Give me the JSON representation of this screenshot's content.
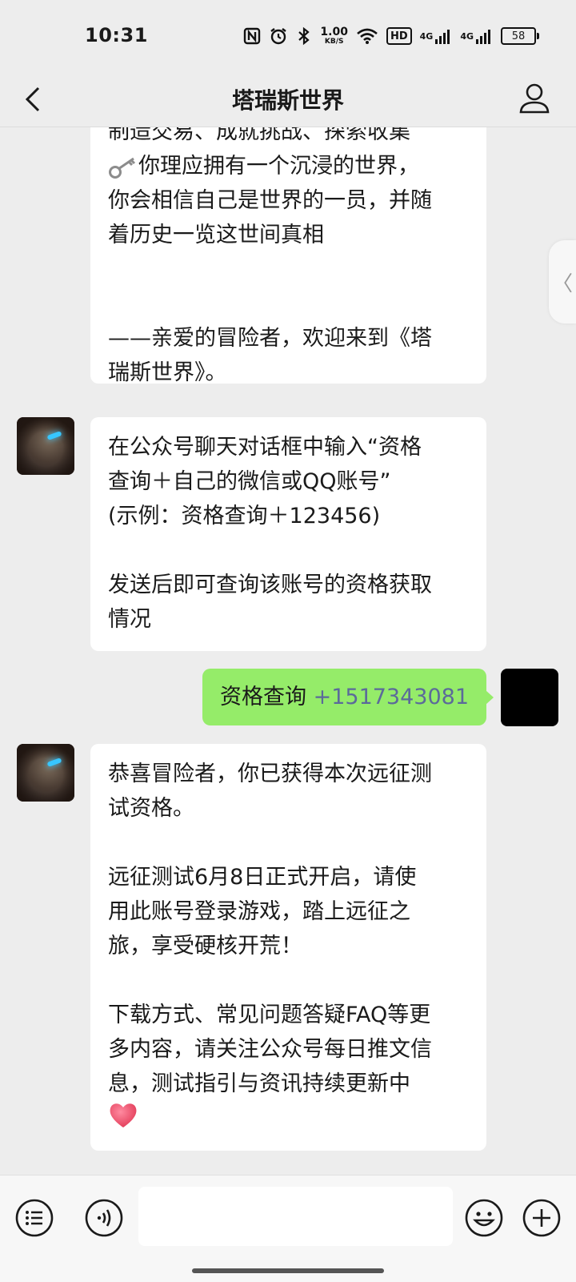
{
  "status_bar": {
    "time": "10:31",
    "net_speed": "1.00",
    "net_unit": "KB/S",
    "hd_label": "HD",
    "signal1": "4G",
    "signal2": "4G",
    "battery": "58"
  },
  "nav": {
    "title": "塔瑞斯世界",
    "icons": [
      "back-icon",
      "profile-icon"
    ]
  },
  "messages": {
    "msg1": {
      "line0": "制造交易、成就挑战、探索收集",
      "line1": "你理应拥有一个沉浸的世界，",
      "line2": "你会相信自己是世界的一员，并随",
      "line3": "着历史一览这世间真相",
      "line4": "——亲爱的冒险者，欢迎来到《塔",
      "line5": "瑞斯世界》。"
    },
    "msg2": {
      "line1": "在公众号聊天对话框中输入“资格",
      "line2": "查询＋自己的微信或QQ账号”",
      "line3": "(示例：资格查询＋123456)",
      "line4": "发送后即可查询该账号的资格获取",
      "line5": "情况"
    },
    "msg3": {
      "prefix": "资格查询",
      "number": "+1517343081"
    },
    "msg4": {
      "line1": "恭喜冒险者，你已获得本次远征测",
      "line2": "试资格。",
      "line3": "远征测试6月8日正式开启，请使",
      "line4": "用此账号登录游戏，踏上远征之",
      "line5": "旅，享受硬核开荒！",
      "line6": "下载方式、常见问题答疑FAQ等更",
      "line7": "多内容，请关注公众号每日推文信",
      "line8": "息，测试指引与资讯持续更新中"
    }
  },
  "side_handle": {
    "glyph": "〈"
  },
  "bottom_bar": {
    "input_value": "",
    "icons": [
      "menu-icon",
      "voice-icon",
      "emoji-icon",
      "plus-icon"
    ]
  },
  "colors": {
    "background": "#ededed",
    "bubble_in": "#ffffff",
    "bubble_out": "#95ec69",
    "number_link": "#5b6a9a"
  }
}
